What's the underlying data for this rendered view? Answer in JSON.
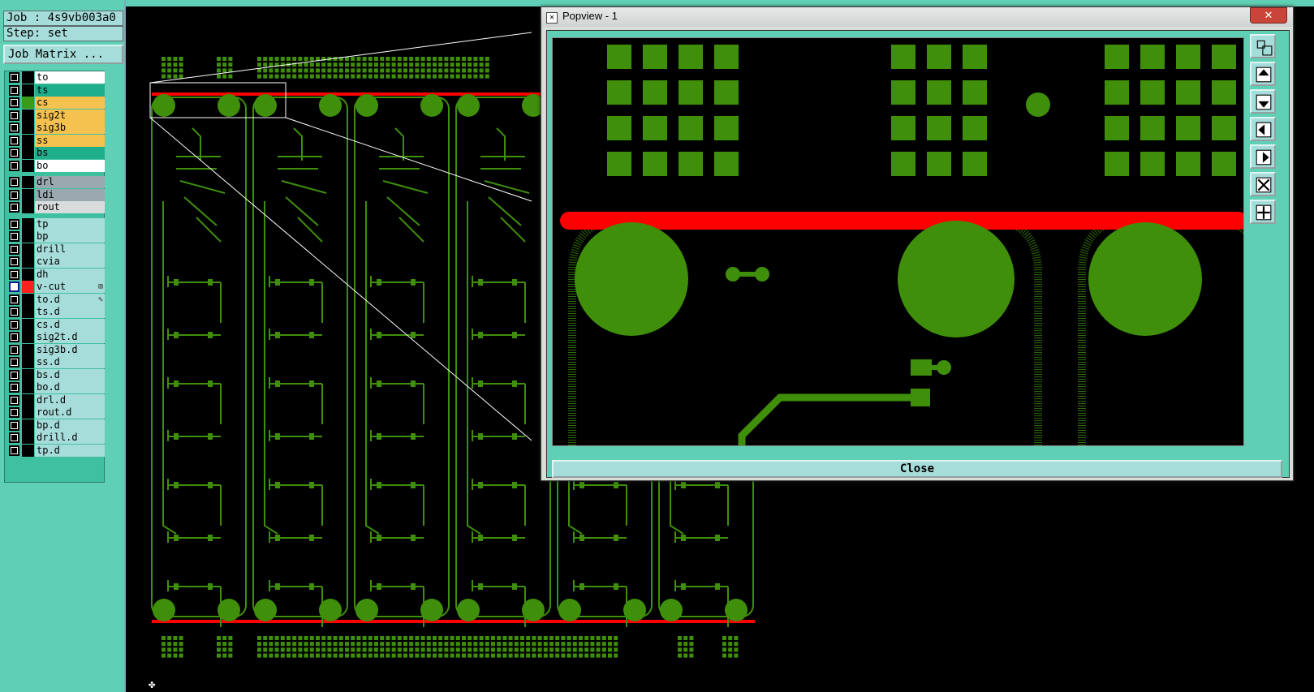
{
  "job_info": {
    "job_label": "Job : 4s9vb003a0",
    "step_label": "Step: set"
  },
  "job_matrix_button": "Job Matrix ...",
  "layers": [
    {
      "name": "to",
      "bg": "#ffffff",
      "swatch": "#000000"
    },
    {
      "name": "ts",
      "bg": "#1fae8c",
      "swatch": "#000000"
    },
    {
      "name": "cs",
      "bg": "#f5c24f",
      "swatch": "#3a9a1a"
    },
    {
      "name": "sig2t",
      "bg": "#f5c24f",
      "swatch": "#000000"
    },
    {
      "name": "sig3b",
      "bg": "#f5c24f",
      "swatch": "#000000"
    },
    {
      "name": "ss",
      "bg": "#f5c24f",
      "swatch": "#000000"
    },
    {
      "name": "bs",
      "bg": "#1fae8c",
      "swatch": "#000000"
    },
    {
      "name": "bo",
      "bg": "#ffffff",
      "swatch": "#000000"
    },
    {
      "name": "drl",
      "bg": "#9aa8b0",
      "swatch": "#000000"
    },
    {
      "name": "ldi",
      "bg": "#9aa8b0",
      "swatch": "#000000"
    },
    {
      "name": "rout",
      "bg": "#d8dcdc",
      "swatch": "#000000"
    },
    {
      "name": "tp",
      "bg": "#a6dcda",
      "swatch": "#000000"
    },
    {
      "name": "bp",
      "bg": "#a6dcda",
      "swatch": "#000000"
    },
    {
      "name": "drill",
      "bg": "#a6dcda",
      "swatch": "#000000"
    },
    {
      "name": "cvia",
      "bg": "#a6dcda",
      "swatch": "#000000"
    },
    {
      "name": "dh",
      "bg": "#a6dcda",
      "swatch": "#000000"
    },
    {
      "name": "v-cut",
      "bg": "#a6dcda",
      "swatch": "#ff2020",
      "checked": true,
      "extra": "⊞"
    },
    {
      "name": "to.d",
      "bg": "#a6dcda",
      "swatch": "#000000",
      "extra": "✎"
    },
    {
      "name": "ts.d",
      "bg": "#a6dcda",
      "swatch": "#000000"
    },
    {
      "name": "cs.d",
      "bg": "#a6dcda",
      "swatch": "#000000"
    },
    {
      "name": "sig2t.d",
      "bg": "#a6dcda",
      "swatch": "#000000"
    },
    {
      "name": "sig3b.d",
      "bg": "#a6dcda",
      "swatch": "#000000"
    },
    {
      "name": "ss.d",
      "bg": "#a6dcda",
      "swatch": "#000000"
    },
    {
      "name": "bs.d",
      "bg": "#a6dcda",
      "swatch": "#000000"
    },
    {
      "name": "bo.d",
      "bg": "#a6dcda",
      "swatch": "#000000"
    },
    {
      "name": "drl.d",
      "bg": "#a6dcda",
      "swatch": "#000000"
    },
    {
      "name": "rout.d",
      "bg": "#a6dcda",
      "swatch": "#000000"
    },
    {
      "name": "bp.d",
      "bg": "#a6dcda",
      "swatch": "#000000"
    },
    {
      "name": "drill.d",
      "bg": "#a6dcda",
      "swatch": "#000000"
    },
    {
      "name": "tp.d",
      "bg": "#a6dcda",
      "swatch": "#000000"
    }
  ],
  "popview": {
    "title": "Popview - 1",
    "close_label": "Close",
    "toolbar_icons": [
      "zoom-fit-icon",
      "pan-up-icon",
      "pan-down-icon",
      "pan-left-icon",
      "pan-right-icon",
      "zoom-in-icon",
      "zoom-out-icon"
    ]
  },
  "colors": {
    "copper": "#3f8f0b",
    "vcut": "#ff0000",
    "panel": "#5fd0b5",
    "button": "#a6dcda"
  }
}
